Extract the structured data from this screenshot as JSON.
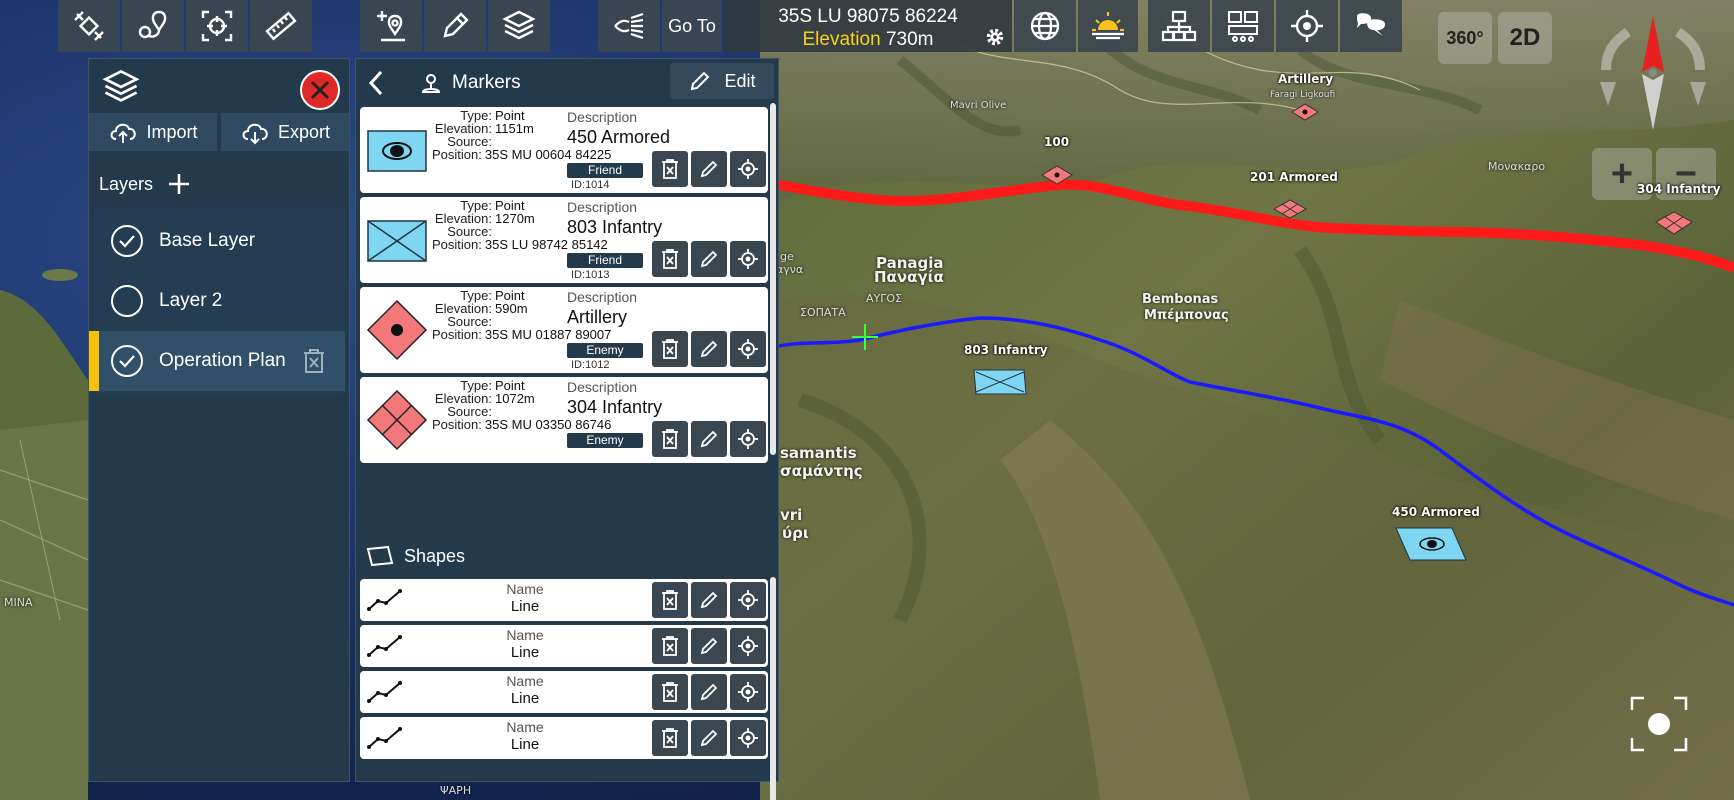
{
  "toolbar": {
    "goto_label": "Go To",
    "coordinate": "35S LU 98075 86224",
    "elevation_label": "Elevation",
    "elevation_value": "730m",
    "icons": [
      "satellite-icon",
      "route-pin-icon",
      "crosshair-frame-icon",
      "ruler-icon",
      "add-marker-icon",
      "pencil-icon",
      "layers-icon",
      "line-of-sight-icon",
      "globe-icon",
      "sun-horizon-icon",
      "network-icon",
      "dashboard-icon",
      "locate-icon",
      "chat-icon"
    ]
  },
  "map_controls": {
    "view_360": "360°",
    "view_2d": "2D"
  },
  "layers_panel": {
    "import_label": "Import",
    "export_label": "Export",
    "title": "Layers",
    "layers": [
      {
        "name": "Base Layer",
        "checked": true
      },
      {
        "name": "Layer 2",
        "checked": false
      },
      {
        "name": "Operation Plan",
        "checked": true
      }
    ]
  },
  "markers_panel": {
    "title": "Markers",
    "edit_label": "Edit",
    "keys": {
      "type": "Type:",
      "elevation": "Elevation:",
      "source": "Source:",
      "position": "Position:",
      "description": "Description",
      "id": "ID:"
    },
    "markers": [
      {
        "type": "Point",
        "elevation": "1151m",
        "source": "",
        "position": "35S MU 00604 84225",
        "description": "450 Armored",
        "affiliation": "Friend",
        "id": "1014",
        "symbol": "friend-armored"
      },
      {
        "type": "Point",
        "elevation": "1270m",
        "source": "",
        "position": "35S LU 98742 85142",
        "description": "803 Infantry",
        "affiliation": "Friend",
        "id": "1013",
        "symbol": "friend-infantry"
      },
      {
        "type": "Point",
        "elevation": "590m",
        "source": "",
        "position": "35S MU 01887 89007",
        "description": "Artillery",
        "affiliation": "Enemy",
        "id": "1012",
        "symbol": "enemy-artillery"
      },
      {
        "type": "Point",
        "elevation": "1072m",
        "source": "",
        "position": "35S MU 03350 86746",
        "description": "304 Infantry",
        "affiliation": "Enemy",
        "id": "",
        "symbol": "enemy-infantry"
      }
    ],
    "shapes_title": "Shapes",
    "shapes": [
      {
        "name_label": "Name",
        "name": "Line"
      },
      {
        "name_label": "Name",
        "name": "Line"
      },
      {
        "name_label": "Name",
        "name": "Line"
      },
      {
        "name_label": "Name",
        "name": "Line"
      }
    ]
  },
  "map_labels": {
    "artillery": "Artillery",
    "marker_100": "100",
    "armored_201": "201 Armored",
    "infantry_304": "304 Infantry",
    "infantry_803": "803 Infantry",
    "armored_450": "450 Armored",
    "panagia": "Panagia",
    "panagia_gr": "Παναγία",
    "bembonas": "Bembonas",
    "bembonas_gr": "Μπέμπονας",
    "samantis": "samantis",
    "samantis_gr": "σαμάντης",
    "vri": "vri",
    "vri_gr": "ύρι",
    "sopata": "ΣΟΠΑΤΑ",
    "argos": "ΑΥΓΟΣ",
    "ge": "ge",
    "gr_frag": "αγνα",
    "mina": "MINA",
    "fari": "ΨΑΡΗ",
    "monakaro": "Μονακαρο",
    "mavri_olive": "Mavri Olive",
    "fragi": "Faragi Ligkoufi"
  },
  "colors": {
    "friend": "#7fd6f2",
    "enemy": "#f2787a",
    "panel": "#23394c",
    "red_line": "#ff1a1a",
    "blue_line": "#1a1aff",
    "accent": "#f4c20d"
  }
}
